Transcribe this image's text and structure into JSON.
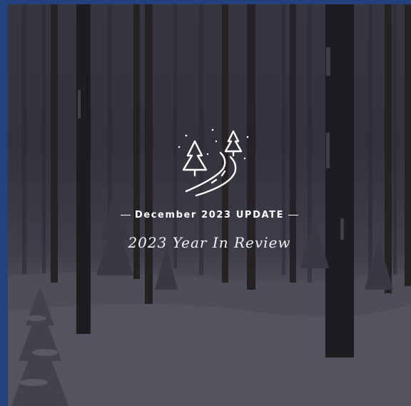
{
  "hero": {
    "kicker": "December 2023 UPDATE",
    "title": "2023 Year In Review",
    "logo_icon": "forest-road-icon"
  },
  "colors": {
    "frame": "#23407f",
    "text": "#ffffff"
  }
}
